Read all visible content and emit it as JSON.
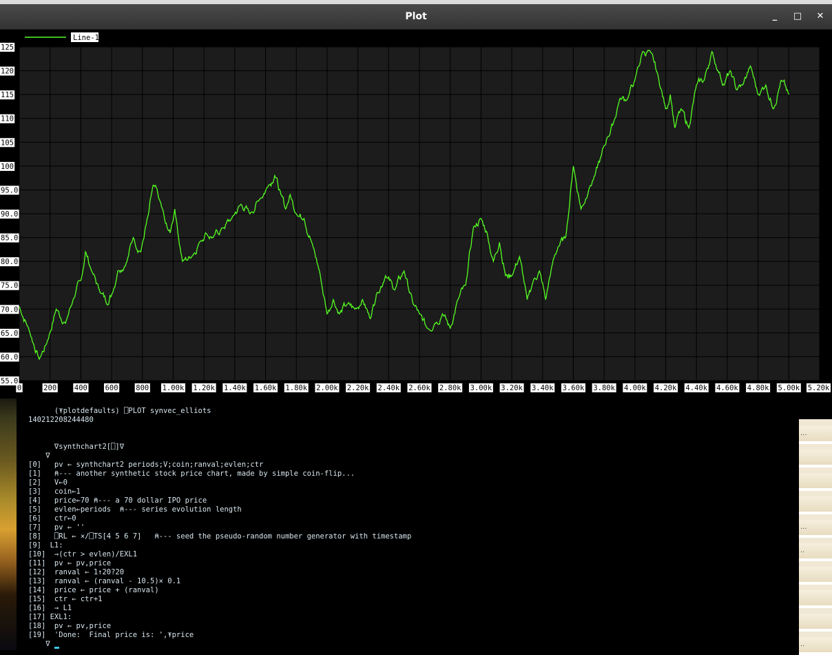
{
  "window": {
    "title": "Plot",
    "buttons": {
      "minimize": "_",
      "maximize": "□",
      "close": "✕"
    }
  },
  "chart_data": {
    "type": "line",
    "legend": "Line-1",
    "legend_position": "top-left",
    "grid": true,
    "color": "#55ff22",
    "xlim": [
      0,
      5200
    ],
    "ylim": [
      55,
      125
    ],
    "x_ticks": [
      {
        "v": 0,
        "label": "0"
      },
      {
        "v": 200,
        "label": "200"
      },
      {
        "v": 400,
        "label": "400"
      },
      {
        "v": 600,
        "label": "600"
      },
      {
        "v": 800,
        "label": "800"
      },
      {
        "v": 1000,
        "label": "1.00k"
      },
      {
        "v": 1200,
        "label": "1.20k"
      },
      {
        "v": 1400,
        "label": "1.40k"
      },
      {
        "v": 1600,
        "label": "1.60k"
      },
      {
        "v": 1800,
        "label": "1.80k"
      },
      {
        "v": 2000,
        "label": "2.00k"
      },
      {
        "v": 2200,
        "label": "2.20k"
      },
      {
        "v": 2400,
        "label": "2.40k"
      },
      {
        "v": 2600,
        "label": "2.60k"
      },
      {
        "v": 2800,
        "label": "2.80k"
      },
      {
        "v": 3000,
        "label": "3.00k"
      },
      {
        "v": 3200,
        "label": "3.20k"
      },
      {
        "v": 3400,
        "label": "3.40k"
      },
      {
        "v": 3600,
        "label": "3.60k"
      },
      {
        "v": 3800,
        "label": "3.80k"
      },
      {
        "v": 4000,
        "label": "4.00k"
      },
      {
        "v": 4200,
        "label": "4.20k"
      },
      {
        "v": 4400,
        "label": "4.40k"
      },
      {
        "v": 4600,
        "label": "4.60k"
      },
      {
        "v": 4800,
        "label": "4.80k"
      },
      {
        "v": 5000,
        "label": "5.00k"
      },
      {
        "v": 5200,
        "label": "5.20k"
      }
    ],
    "y_ticks": [
      {
        "v": 55,
        "label": "55.0"
      },
      {
        "v": 60,
        "label": "60.0"
      },
      {
        "v": 65,
        "label": "65.0"
      },
      {
        "v": 70,
        "label": "70.0"
      },
      {
        "v": 75,
        "label": "75.0"
      },
      {
        "v": 80,
        "label": "80.0"
      },
      {
        "v": 85,
        "label": "85.0"
      },
      {
        "v": 90,
        "label": "90.0"
      },
      {
        "v": 95,
        "label": "95.0"
      },
      {
        "v": 100,
        "label": "100"
      },
      {
        "v": 105,
        "label": "105"
      },
      {
        "v": 110,
        "label": "110"
      },
      {
        "v": 115,
        "label": "115"
      },
      {
        "v": 120,
        "label": "120"
      },
      {
        "v": 125,
        "label": "125"
      }
    ],
    "series": [
      {
        "name": "Line-1",
        "x": [
          0,
          60,
          130,
          180,
          240,
          300,
          350,
          400,
          430,
          470,
          520,
          580,
          600,
          640,
          700,
          740,
          790,
          840,
          870,
          910,
          950,
          980,
          1010,
          1060,
          1120,
          1170,
          1210,
          1260,
          1320,
          1380,
          1440,
          1500,
          1560,
          1620,
          1660,
          1700,
          1730,
          1760,
          1800,
          1850,
          1900,
          1950,
          2000,
          2040,
          2080,
          2130,
          2180,
          2230,
          2280,
          2320,
          2380,
          2440,
          2500,
          2560,
          2600,
          2650,
          2700,
          2750,
          2800,
          2850,
          2900,
          2950,
          3000,
          3040,
          3080,
          3120,
          3160,
          3200,
          3250,
          3300,
          3340,
          3380,
          3420,
          3460,
          3500,
          3550,
          3600,
          3650,
          3700,
          3740,
          3780,
          3820,
          3860,
          3900,
          3950,
          4000,
          4050,
          4100,
          4150,
          4200,
          4230,
          4260,
          4300,
          4350,
          4400,
          4450,
          4500,
          4540,
          4580,
          4620,
          4660,
          4700,
          4750,
          4800,
          4850,
          4900,
          4950,
          5000
        ],
        "y": [
          70.5,
          66,
          59.5,
          63,
          70,
          67,
          72,
          76,
          82,
          78,
          74,
          71,
          73,
          78,
          80,
          85,
          82,
          90,
          96,
          93,
          88,
          86,
          91,
          80,
          81,
          84,
          86,
          85,
          87,
          89,
          92,
          90,
          93,
          96,
          98,
          94,
          91,
          94,
          90,
          89,
          84,
          78,
          69,
          72,
          69,
          71,
          70,
          72,
          68,
          73,
          77,
          74,
          78,
          71,
          69,
          66,
          67,
          69,
          66,
          72,
          75,
          87,
          89,
          86,
          80,
          84,
          77,
          77,
          81,
          72,
          76,
          78,
          72,
          79,
          83,
          85,
          100,
          91,
          95,
          98,
          102,
          106,
          109,
          114,
          114,
          118,
          124,
          124,
          119,
          112,
          115,
          108,
          112,
          108,
          117,
          118,
          124,
          120,
          117,
          120,
          116,
          117,
          121,
          115,
          117,
          112,
          118,
          115
        ]
      }
    ]
  },
  "terminal": {
    "lines": [
      {
        "text": "      (⍕plotdefaults) ⎕PLOT synvec_elliots"
      },
      {
        "text": "140212208244480"
      },
      {
        "text": ""
      },
      {
        "text": ""
      },
      {
        "text": "      ∇synthchart2[⎕]∇"
      },
      {
        "text": "    ∇"
      },
      {
        "text": "[0]   pv ← synthchart2 periods;V;coin;ranval;evlen;ctr"
      },
      {
        "text": "[1]   ⍝--- another synthetic stock price chart, made by simple coin-flip..."
      },
      {
        "text": "[2]   V←0"
      },
      {
        "text": "[3]   coin←1"
      },
      {
        "text": "[4]   price←70 ⍝--- a 70 dollar IPO price"
      },
      {
        "text": "[5]   evlen←periods  ⍝--- series evolution length"
      },
      {
        "text": "[6]   ctr←0"
      },
      {
        "text": "[7]   pv ← ''"
      },
      {
        "text": "[8]   ⎕RL ← ×/⎕TS[4 5 6 7]   ⍝--- seed the pseudo-random number generator with timestamp"
      },
      {
        "text": "[9]  L1:"
      },
      {
        "text": "[10]  →(ctr > evlen)/EXL1"
      },
      {
        "text": "[11]  pv ← pv,price"
      },
      {
        "text": "[12]  ranval ← 1↑20?20"
      },
      {
        "text": "[13]  ranval ← (ranval - 10.5)× 0.1"
      },
      {
        "text": "[14]  price ← price + (ranval)"
      },
      {
        "text": "[15]  ctr ← ctr+1"
      },
      {
        "text": "[16]  → L1"
      },
      {
        "text": "[17] EXL1:"
      },
      {
        "text": "[18]  pv ← pv,price"
      },
      {
        "text": "[19]  'Done:  Final price is: ',⍕price"
      },
      {
        "text": "    ∇"
      }
    ]
  },
  "side_panel": {
    "items": [
      "...",
      "",
      "",
      "",
      "...",
      "..",
      "",
      "",
      "",
      ".."
    ]
  }
}
